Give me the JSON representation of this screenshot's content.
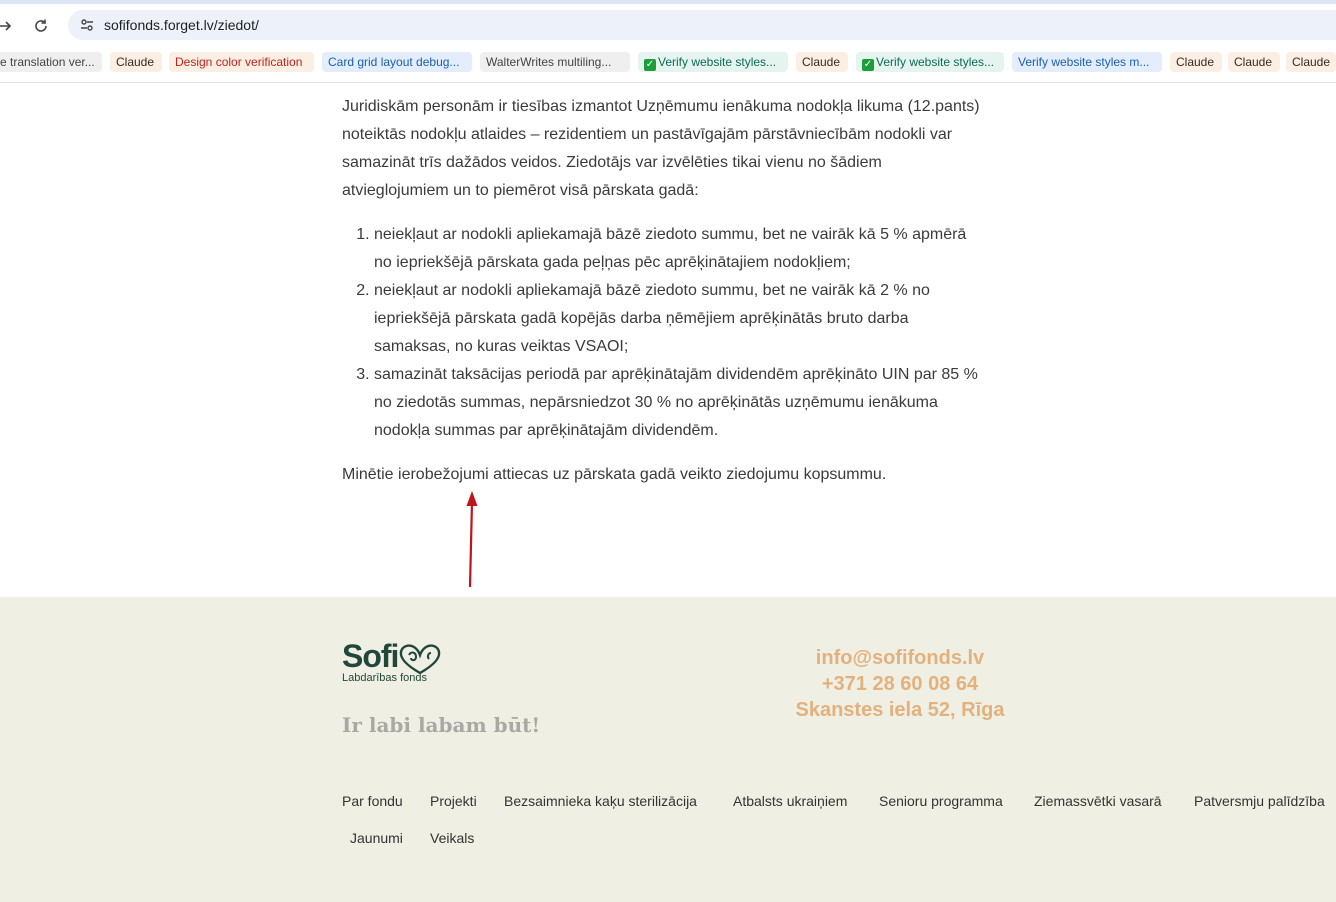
{
  "browser": {
    "url": "sofifonds.forget.lv/ziedot/",
    "bookmarks": [
      {
        "label": "e translation ver...",
        "style": "grey"
      },
      {
        "label": "Claude",
        "style": "peach"
      },
      {
        "label": "Design color verification",
        "style": "red"
      },
      {
        "label": "Card grid layout debug...",
        "style": "blue"
      },
      {
        "label": "WalterWrites multiling...",
        "style": "grey"
      },
      {
        "label": "Verify website styles...",
        "style": "green"
      },
      {
        "label": "Claude",
        "style": "peach"
      },
      {
        "label": "Verify website styles...",
        "style": "green"
      },
      {
        "label": "Verify website styles m...",
        "style": "blue"
      },
      {
        "label": "Claude",
        "style": "peach"
      },
      {
        "label": "Claude",
        "style": "peach"
      },
      {
        "label": "Claude",
        "style": "peach"
      }
    ]
  },
  "article": {
    "intro": "Juridiskām personām ir tiesības izmantot Uzņēmumu ienākuma nodokļa likuma (12.pants) noteiktās nodokļu atlaides – rezidentiem un pastāvīgajām pārstāvniecībām nodokli var samazināt trīs dažādos veidos. Ziedotājs var izvēlēties tikai vienu no šādiem atvieglojumiem un to piemērot visā pārskata gadā:",
    "items": [
      "neiekļaut ar nodokli apliekamajā bāzē ziedoto summu, bet ne vairāk kā 5 % apmērā no iepriekšējā pārskata gada peļņas pēc aprēķinātajiem nodokļiem;",
      "neiekļaut ar nodokli apliekamajā bāzē ziedoto summu, bet ne vairāk kā 2 % no iepriekšējā pārskata gadā kopējās darba ņēmējiem aprēķinātās bruto darba samaksas, no kuras veiktas VSAOI;",
      "samazināt taksācijas periodā par aprēķinātajām dividendēm aprēķināto UIN par 85 % no ziedotās summas, nepārsniedzot 30 % no aprēķinātās uzņēmumu ienākuma nodokļa summas par aprēķinātajām dividendēm."
    ],
    "closing": "Minētie ierobežojumi attiecas uz pārskata gadā veikto ziedojumu kopsummu."
  },
  "footer": {
    "logo_word": "Sofi",
    "logo_sub": "Labdarības fonds",
    "tagline": "Ir labi labam būt!",
    "email": "info@sofifonds.lv",
    "phone": "+371 28 60 08 64",
    "address": "Skanstes iela 52, Rīga",
    "menu_row1": [
      "Par fondu",
      "Projekti",
      "Bezsaimnieka kaķu sterilizācija",
      "Atbalsts ukraiņiem",
      "Senioru programma",
      "Ziemassvētki vasarā",
      "Patversmju palīdzība"
    ],
    "menu_row2": [
      "Jaunumi",
      "Veikals"
    ]
  },
  "colors": {
    "footer_bg": "#f0efe4",
    "brand_green": "#21463a",
    "contact_orange": "#e3b17d",
    "annotation_arrow": "#c0141c"
  }
}
